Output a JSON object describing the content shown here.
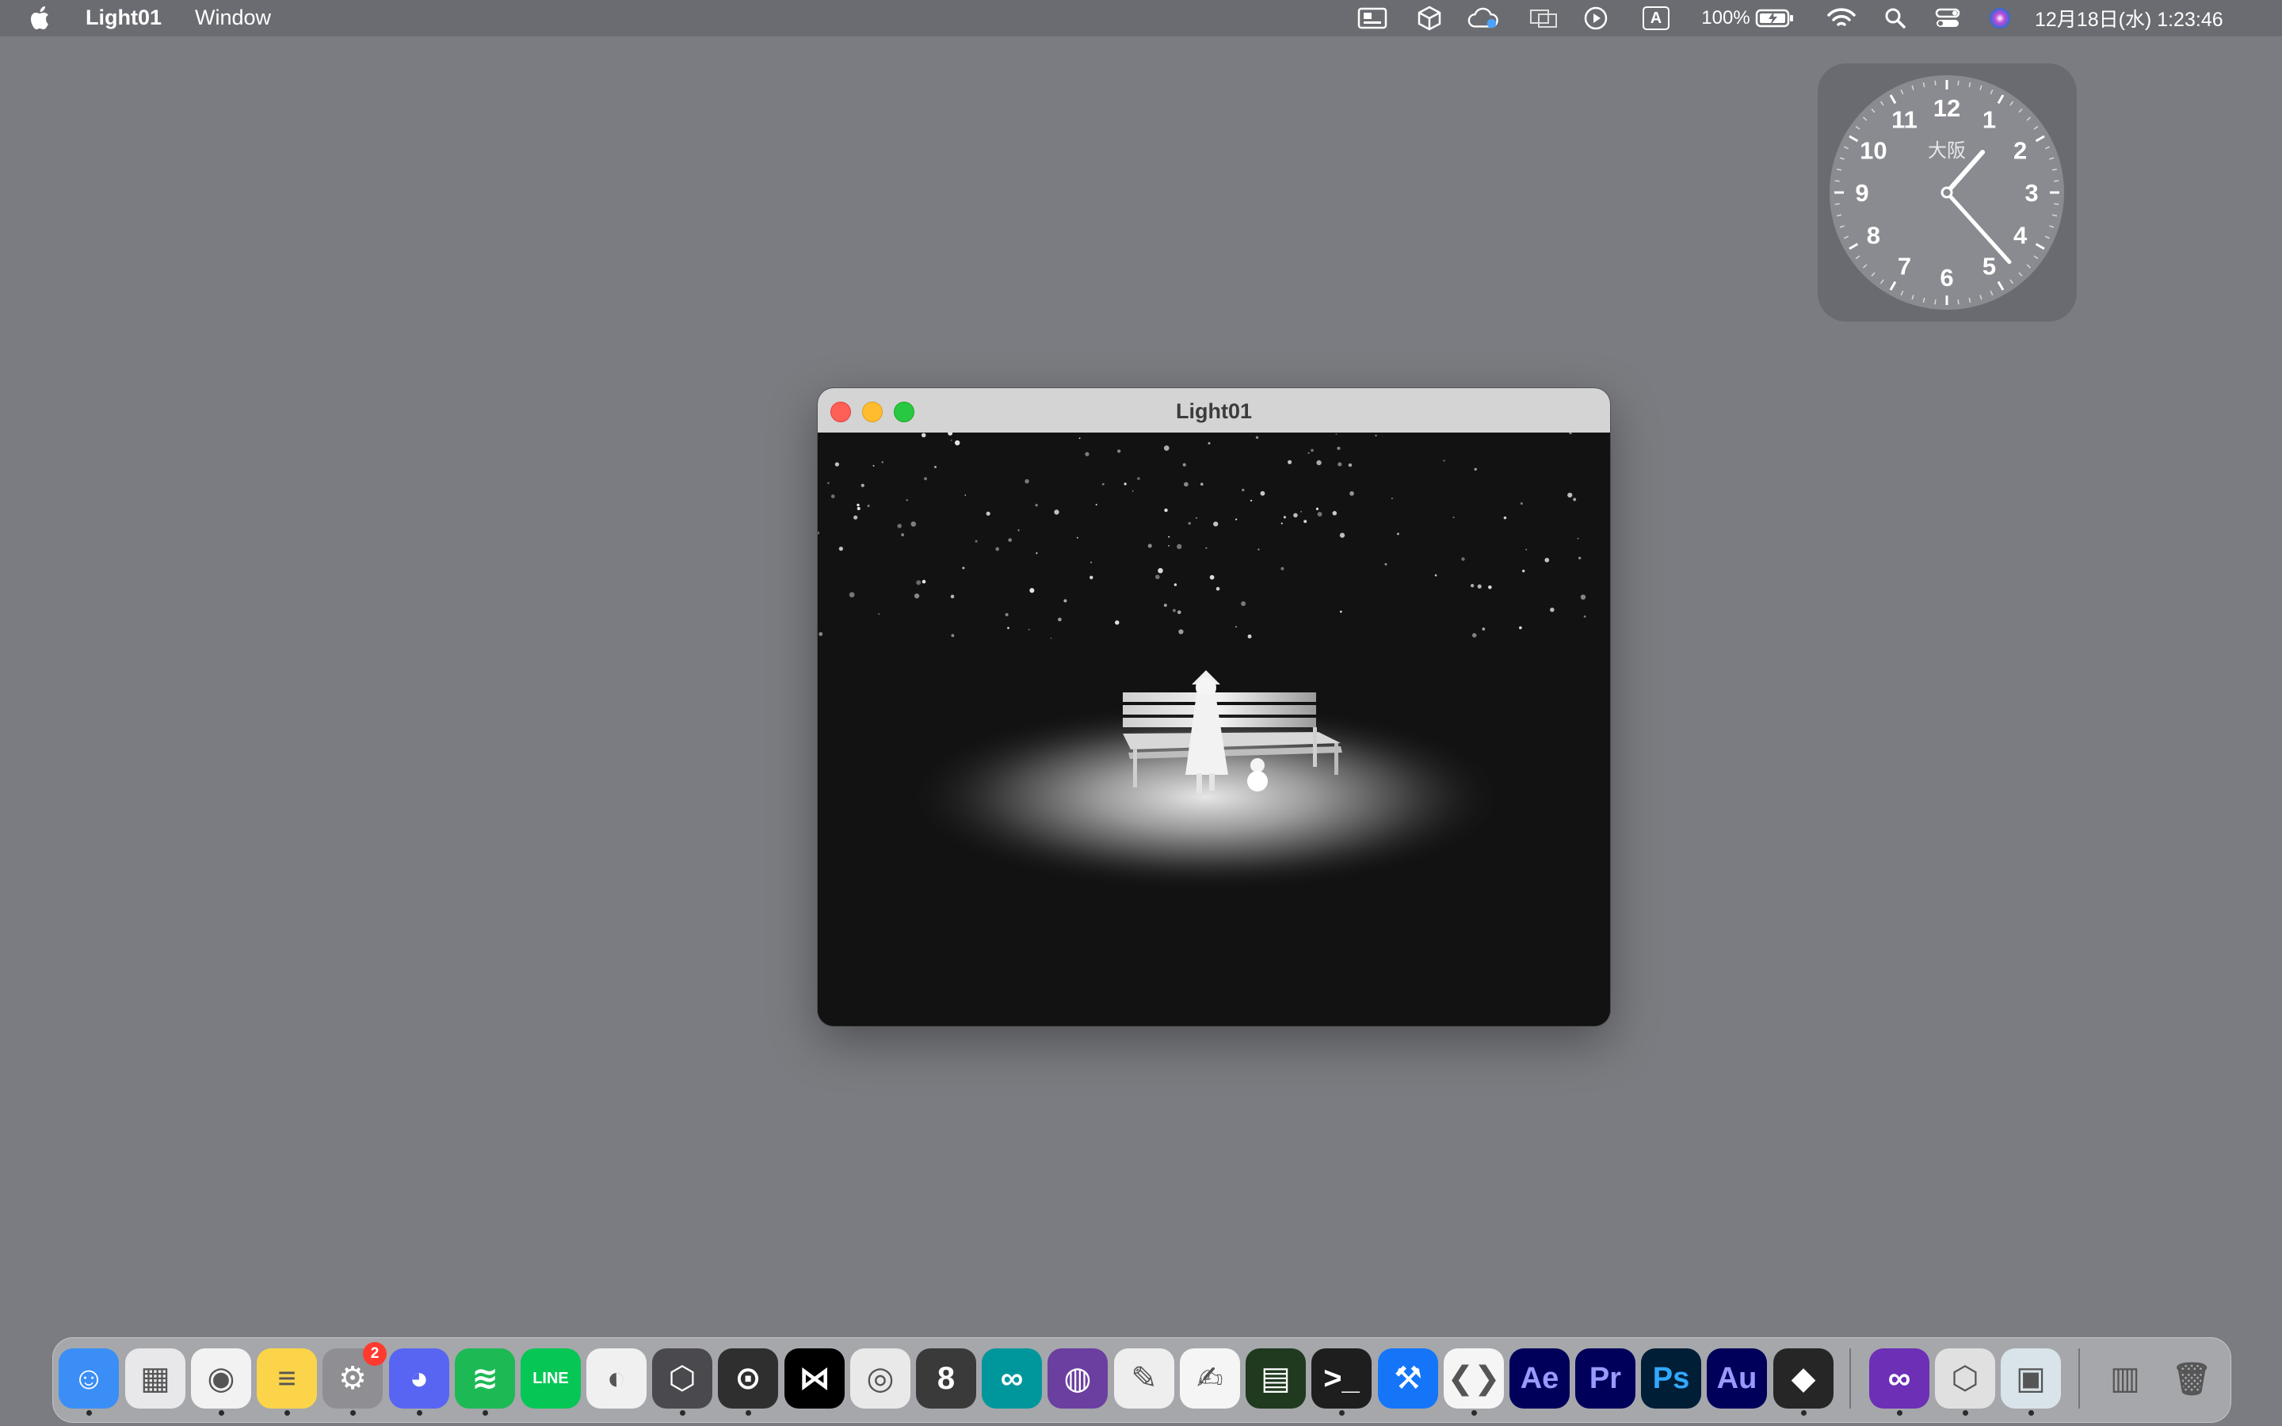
{
  "menubar": {
    "app_name": "Light01",
    "menus": [
      "Window"
    ],
    "status": {
      "battery_percent": "100%",
      "datetime": "12月18日(水)  1:23:46",
      "input_source": "A"
    }
  },
  "clock_widget": {
    "city": "大阪",
    "numbers": [
      "12",
      "1",
      "2",
      "3",
      "4",
      "5",
      "6",
      "7",
      "8",
      "9",
      "10",
      "11"
    ],
    "hour": 1,
    "minute": 23
  },
  "window": {
    "title": "Light01",
    "scene": "Girl standing by a park bench under a spotlight with a small snowman, falling snow on black background"
  },
  "dock": {
    "apps": [
      {
        "name": "Finder",
        "icon": "finder-icon",
        "bg": "#3a8ef6",
        "running": true
      },
      {
        "name": "Launchpad",
        "icon": "launchpad-icon",
        "bg": "#e8e8ea",
        "running": false
      },
      {
        "name": "Google Chrome",
        "icon": "chrome-icon",
        "bg": "#f2f2f2",
        "running": true
      },
      {
        "name": "Notes",
        "icon": "notes-icon",
        "bg": "#fbd44a",
        "running": true
      },
      {
        "name": "System Settings",
        "icon": "gear-icon",
        "bg": "#8e8e93",
        "running": true,
        "badge": "2"
      },
      {
        "name": "Discord",
        "icon": "discord-icon",
        "bg": "#5865f2",
        "running": true
      },
      {
        "name": "Spotify",
        "icon": "spotify-icon",
        "bg": "#1db954",
        "running": true
      },
      {
        "name": "LINE",
        "icon": "line-icon",
        "bg": "#06c755",
        "running": false
      },
      {
        "name": "Blender",
        "icon": "blender-icon",
        "bg": "#f0f0f0",
        "running": false
      },
      {
        "name": "Unity Hub",
        "icon": "unity-icon",
        "bg": "#4a4a4e",
        "running": true
      },
      {
        "name": "Processing",
        "icon": "processing-icon",
        "bg": "#2f2f2f",
        "running": true
      },
      {
        "name": "CapCut",
        "icon": "capcut-icon",
        "bg": "#000000",
        "running": false
      },
      {
        "name": "Spiral",
        "icon": "spiral-icon",
        "bg": "#e9e9e9",
        "running": false
      },
      {
        "name": "Jasper",
        "icon": "eight-icon",
        "bg": "#3a3a3a",
        "running": false
      },
      {
        "name": "Arduino IDE",
        "icon": "arduino-icon",
        "bg": "#00979c",
        "running": false
      },
      {
        "name": "Proxyman",
        "icon": "proxyman-icon",
        "bg": "#6b3fa0",
        "running": false
      },
      {
        "name": "Script Editor",
        "icon": "script-icon",
        "bg": "#eeeeee",
        "running": false
      },
      {
        "name": "TextEdit",
        "icon": "textedit-icon",
        "bg": "#f5f5f5",
        "running": false
      },
      {
        "name": "Activity Monitor",
        "icon": "monitor-icon",
        "bg": "#1f3a1f",
        "running": false
      },
      {
        "name": "Terminal",
        "icon": "terminal-icon",
        "bg": "#1e1e1e",
        "running": true
      },
      {
        "name": "Xcode",
        "icon": "xcode-icon",
        "bg": "#1575f9",
        "running": false
      },
      {
        "name": "Visual Studio Code",
        "icon": "vscode-icon",
        "bg": "#f5f5f5",
        "running": true
      },
      {
        "name": "After Effects",
        "label": "Ae",
        "icon": "after-effects-icon",
        "bg": "#00005b",
        "fg": "#9999ff",
        "running": false
      },
      {
        "name": "Premiere Pro",
        "label": "Pr",
        "icon": "premiere-icon",
        "bg": "#00005b",
        "fg": "#9999ff",
        "running": false
      },
      {
        "name": "Photoshop",
        "label": "Ps",
        "icon": "photoshop-icon",
        "bg": "#001e36",
        "fg": "#31a8ff",
        "running": false
      },
      {
        "name": "Audition",
        "label": "Au",
        "icon": "audition-icon",
        "bg": "#00005b",
        "fg": "#9999ff",
        "running": false
      },
      {
        "name": "Obsidian",
        "icon": "obsidian-icon",
        "bg": "#262626",
        "running": true
      },
      {
        "name": "Visual Studio",
        "icon": "visual-studio-icon",
        "bg": "#6c2fb5",
        "running": true
      },
      {
        "name": "Unity",
        "icon": "unity-editor-icon",
        "bg": "#e0e0e0",
        "running": true
      },
      {
        "name": "Preview",
        "icon": "preview-icon",
        "bg": "#d9e4ea",
        "running": true
      },
      {
        "name": "Downloads",
        "icon": "downloads-stack-icon",
        "bg": "transparent",
        "running": false
      },
      {
        "name": "Trash",
        "icon": "trash-icon",
        "bg": "transparent",
        "running": false
      }
    ]
  }
}
